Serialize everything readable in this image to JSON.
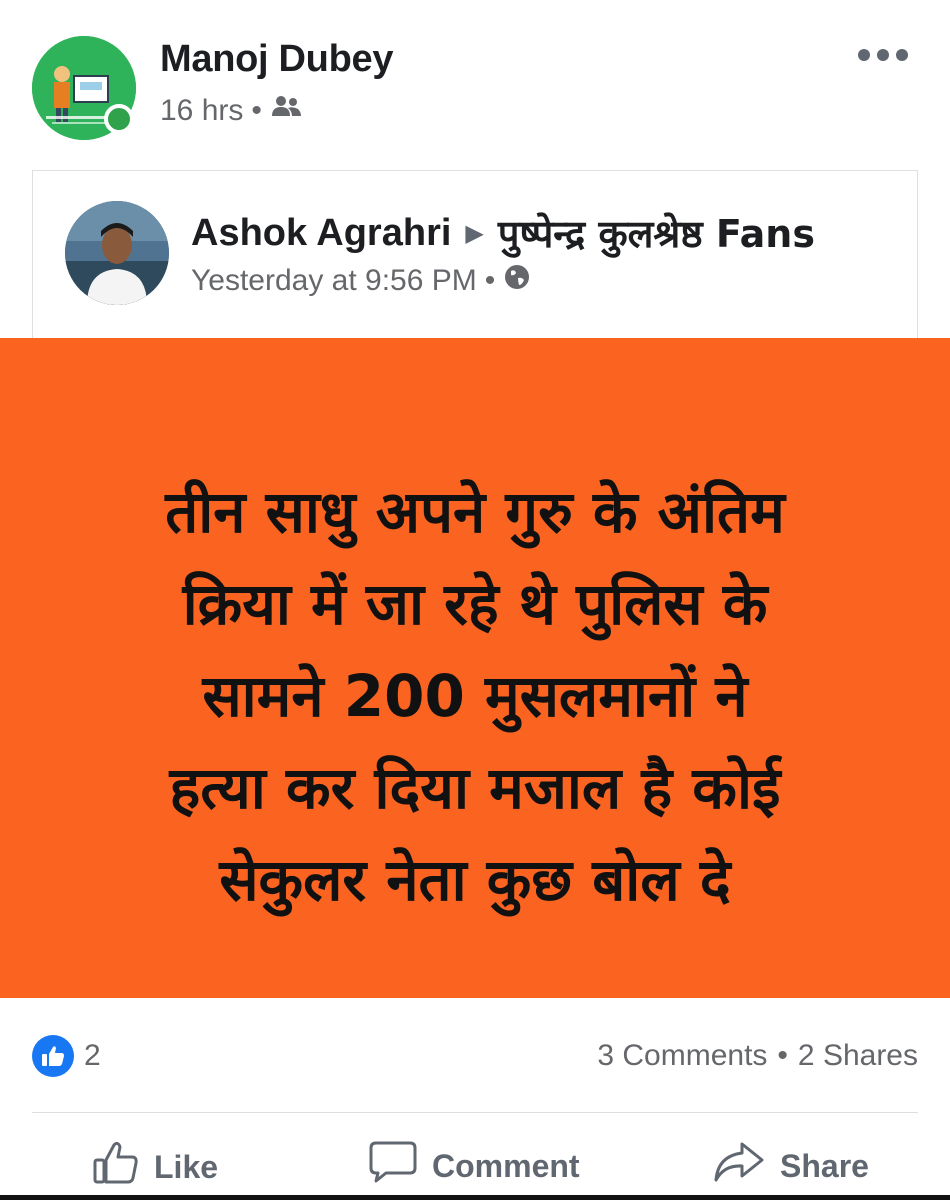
{
  "post": {
    "author": "Manoj Dubey",
    "time": "16 hrs",
    "separator": "•",
    "audience_icon": "friends-icon"
  },
  "shared_post": {
    "author": "Ashok Agrahri",
    "arrow": "▶",
    "group": "पुष्पेन्द्र कुलश्रेष्ठ Fans",
    "time": "Yesterday at 9:56 PM",
    "separator": "•",
    "audience_icon": "globe-icon",
    "image_text_lines": [
      "तीन साधु अपने गुरु के अंतिम",
      "क्रिया में जा रहे थे पुलिस के",
      "सामने 200 मुसलमानों ने",
      "हत्या कर दिया मजाल है कोई",
      "सेकुलर नेता कुछ बोल दे"
    ],
    "image_background": "#fb6320"
  },
  "stats": {
    "like_count": "2",
    "comments": "3 Comments",
    "separator": "•",
    "shares": "2 Shares"
  },
  "actions": {
    "like": "Like",
    "comment": "Comment",
    "share": "Share"
  },
  "colors": {
    "accent_blue": "#1877f2",
    "online_green": "#31a24c",
    "secondary_text": "#65676b"
  }
}
